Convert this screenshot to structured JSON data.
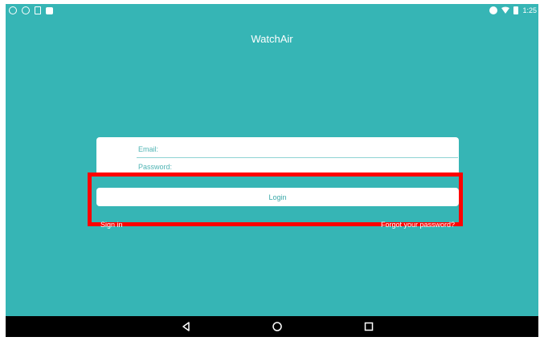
{
  "status_bar": {
    "time": "1:25",
    "left_icons": [
      "sync-icon",
      "shield-icon",
      "sim-card-icon",
      "notification-icon"
    ],
    "right_icons": [
      "do-not-disturb-icon",
      "wifi-icon",
      "battery-icon"
    ]
  },
  "app": {
    "title": "WatchAir"
  },
  "form": {
    "email_placeholder": "Email:",
    "email_value": "",
    "password_placeholder": "Password:",
    "password_value": ""
  },
  "actions": {
    "login_label": "Login",
    "sign_in_label": "Sign in",
    "forgot_label": "Forgot your password?"
  },
  "nav_bar": {
    "icons": [
      "back-icon",
      "home-icon",
      "recents-icon"
    ]
  },
  "colors": {
    "background": "#36b5b5",
    "accent_text": "#3aa8a8",
    "highlight": "#ff0000",
    "nav_bar": "#000000"
  }
}
